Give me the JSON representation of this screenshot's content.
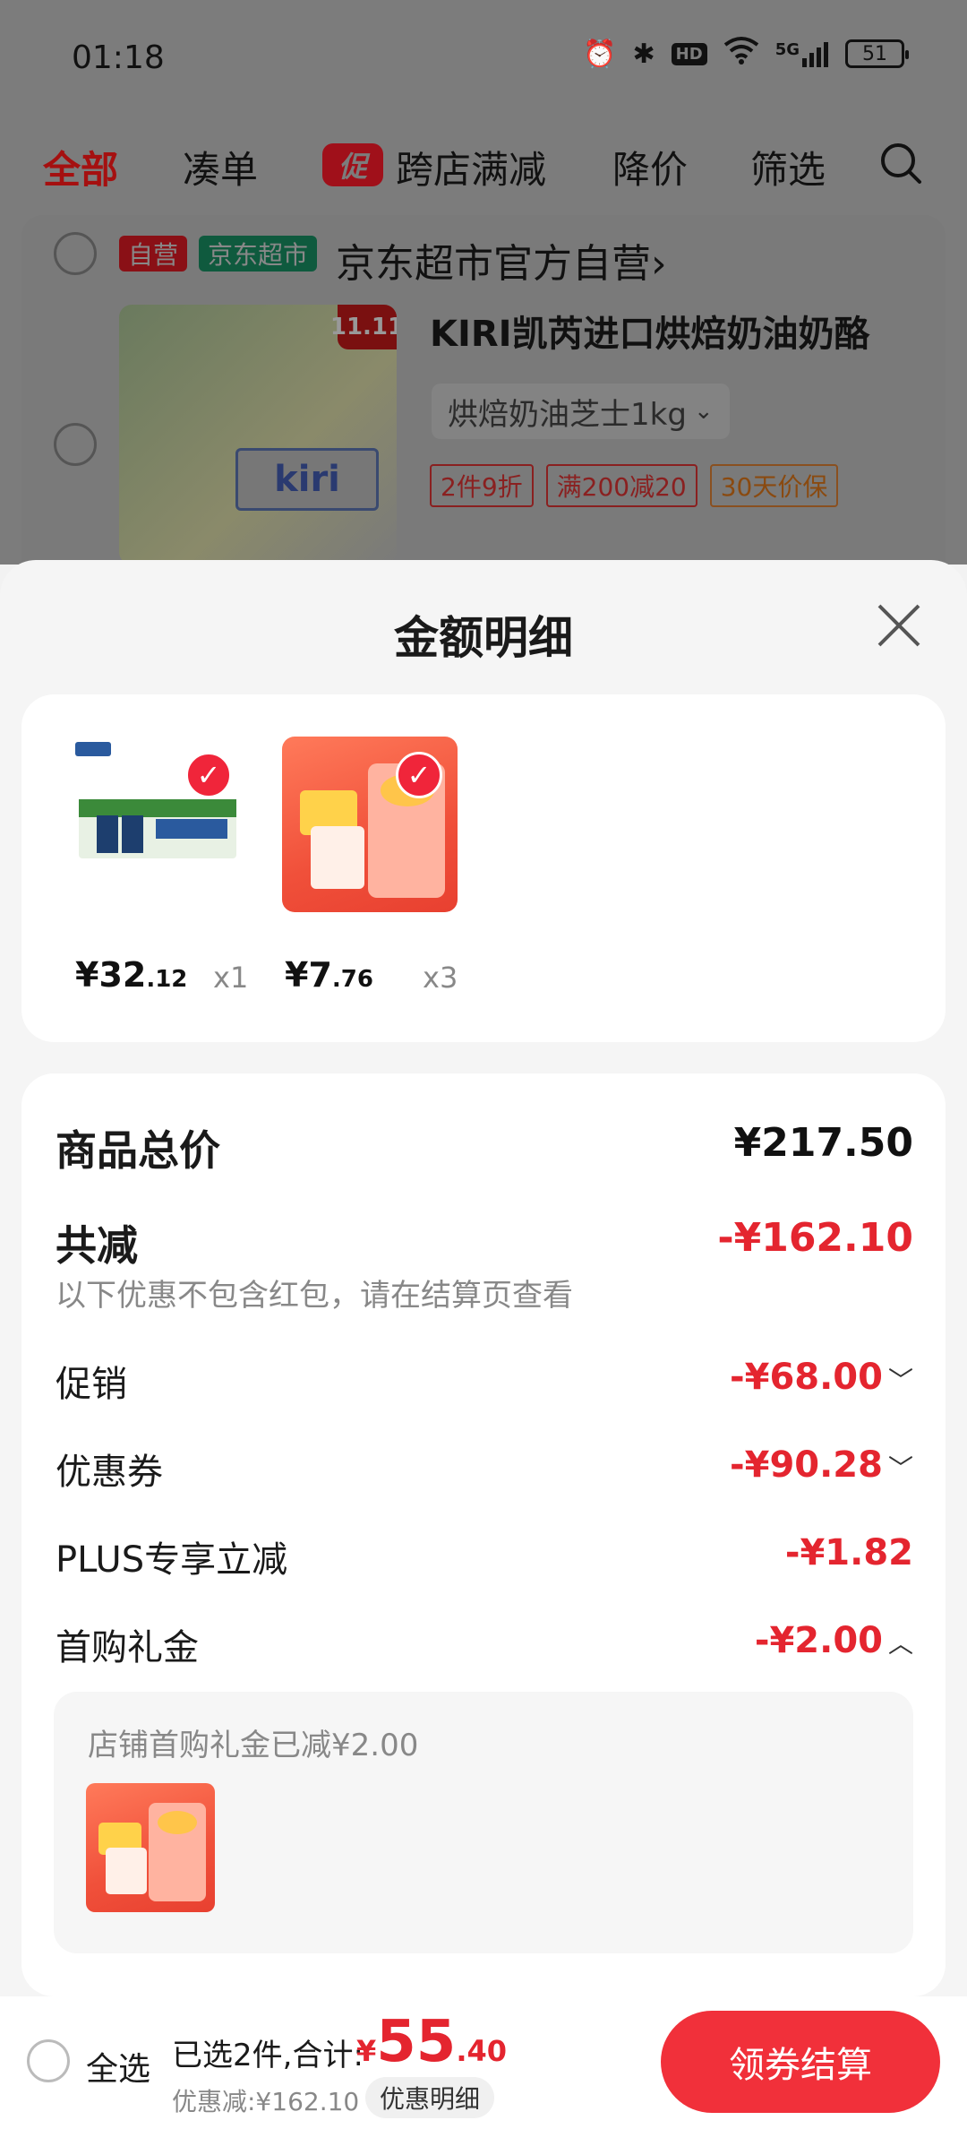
{
  "status": {
    "time": "01:18",
    "battery": "51",
    "signal_label": "5G",
    "hd_label": "HD"
  },
  "tabs": [
    "全部",
    "凑单",
    "跨店满减",
    "降价",
    "筛选"
  ],
  "promo_badge": "促",
  "store": {
    "tag_self": "自营",
    "tag_jd": "京东超市",
    "name": "京东超市官方自营",
    "chevron": "›",
    "product": {
      "title": "KIRI凯芮进口烘焙奶油奶酪",
      "spec": "烘焙奶油芝士1kg",
      "spec_chevron": "⌄",
      "tags": [
        "2件9折",
        "满200减20",
        "30天价保"
      ],
      "image_badge": "11.11",
      "image_logo": "kiri"
    }
  },
  "sheet": {
    "title": "金额明细",
    "items": [
      {
        "price_int": "¥32",
        "price_dec": ".12",
        "qty": "x1"
      },
      {
        "price_int": "¥7",
        "price_dec": ".76",
        "qty": "x3"
      }
    ],
    "summary": {
      "total_label": "商品总价",
      "total_value": "¥217.50",
      "reduce_label": "共减",
      "reduce_value": "-¥162.10",
      "hint": "以下优惠不包含红包，请在结算页查看",
      "rows": [
        {
          "label": "促销",
          "value": "-¥68.00",
          "chevron": "﹀"
        },
        {
          "label": "优惠券",
          "value": "-¥90.28",
          "chevron": "﹀"
        },
        {
          "label": "PLUS专享立减",
          "value": "-¥1.82",
          "chevron": ""
        },
        {
          "label": "首购礼金",
          "value": "-¥2.00",
          "chevron": "︿"
        }
      ],
      "gift_text": "店铺首购礼金已减¥2.00"
    }
  },
  "bottom": {
    "select_all": "全选",
    "selected": "已选2件,合计:",
    "total_yen": "¥",
    "total_int": "55",
    "total_dec": ".40",
    "discount": "优惠减:¥162.10",
    "detail_button": "优惠明细",
    "checkout": "领券结算"
  },
  "colors": {
    "accent": "#e4252f",
    "checkout": "#f1303a"
  }
}
